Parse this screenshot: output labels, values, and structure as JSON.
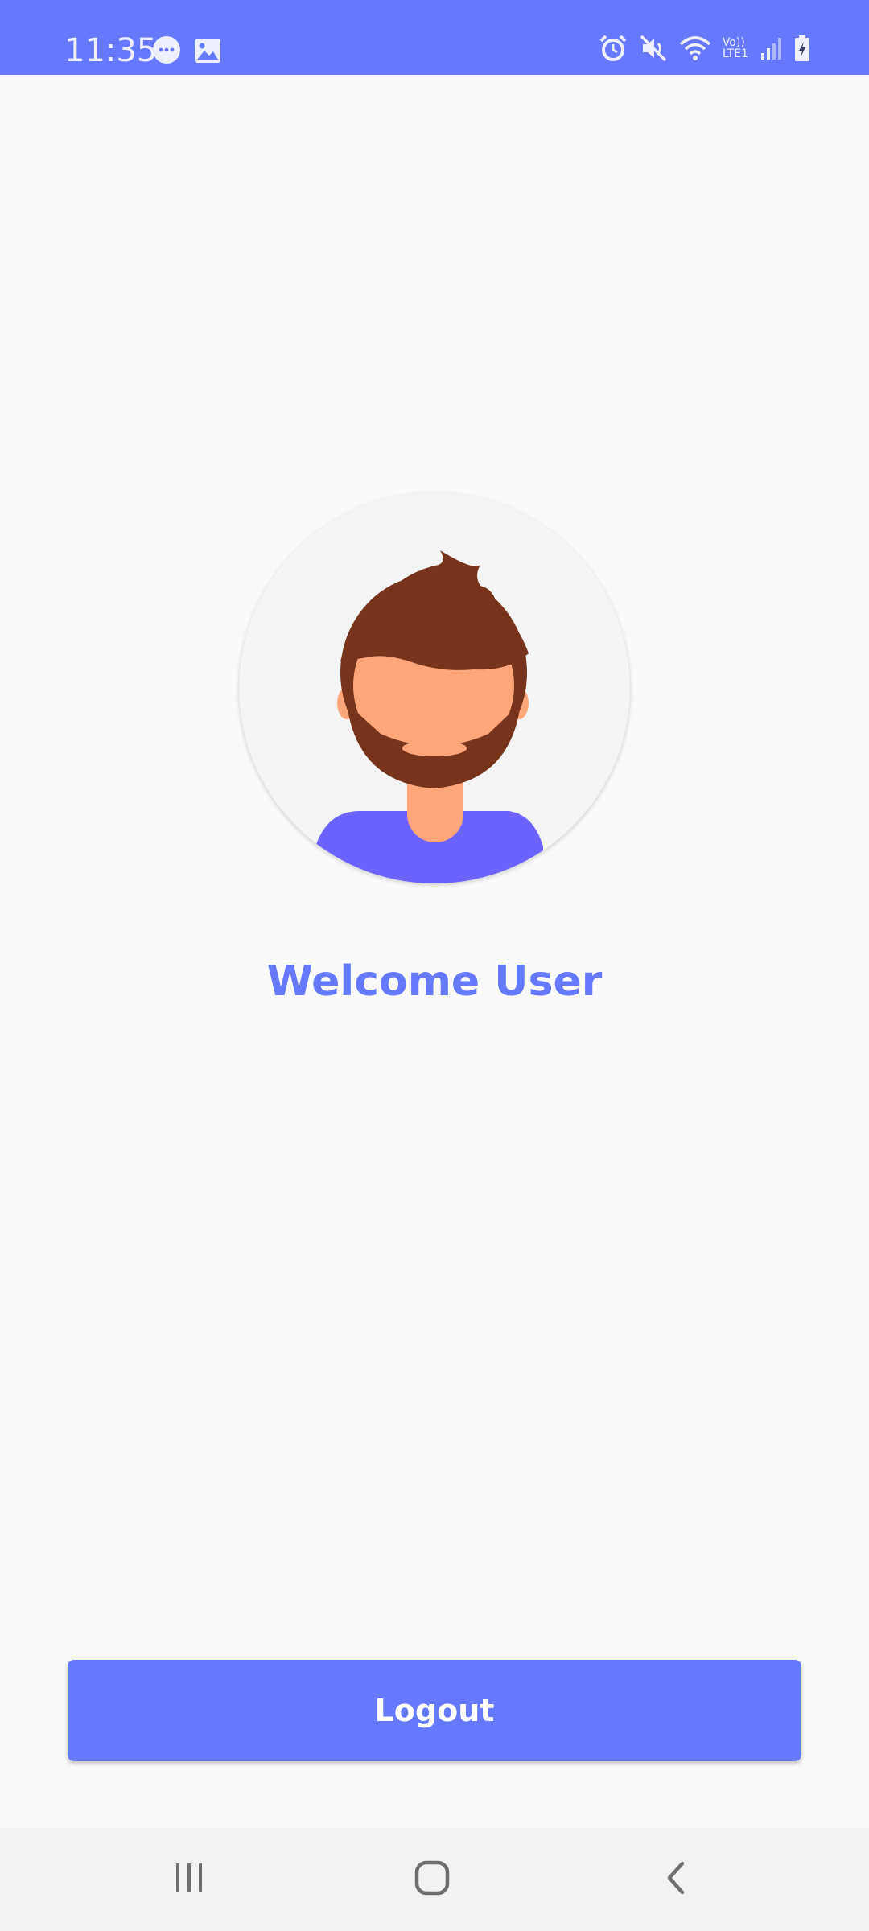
{
  "status_bar": {
    "time": "11:35",
    "lte_top": "Vo))",
    "lte_bottom": "LTE1",
    "icons": [
      "chat-bubble-icon",
      "image-icon",
      "alarm-icon",
      "mute-icon",
      "wifi-icon",
      "signal-icon",
      "battery-charging-icon"
    ]
  },
  "main": {
    "welcome_text": "Welcome User",
    "logout_label": "Logout"
  },
  "colors": {
    "accent": "#6479fe",
    "background": "#fafafa",
    "avatar_bg": "#f4f4f4",
    "hair": "#77341b",
    "skin": "#ffa67a",
    "shirt": "#6c63ff",
    "nav_bar": "#f2f2f2"
  },
  "nav_bar": {
    "icons": [
      "recents-icon",
      "home-icon",
      "back-icon"
    ]
  }
}
